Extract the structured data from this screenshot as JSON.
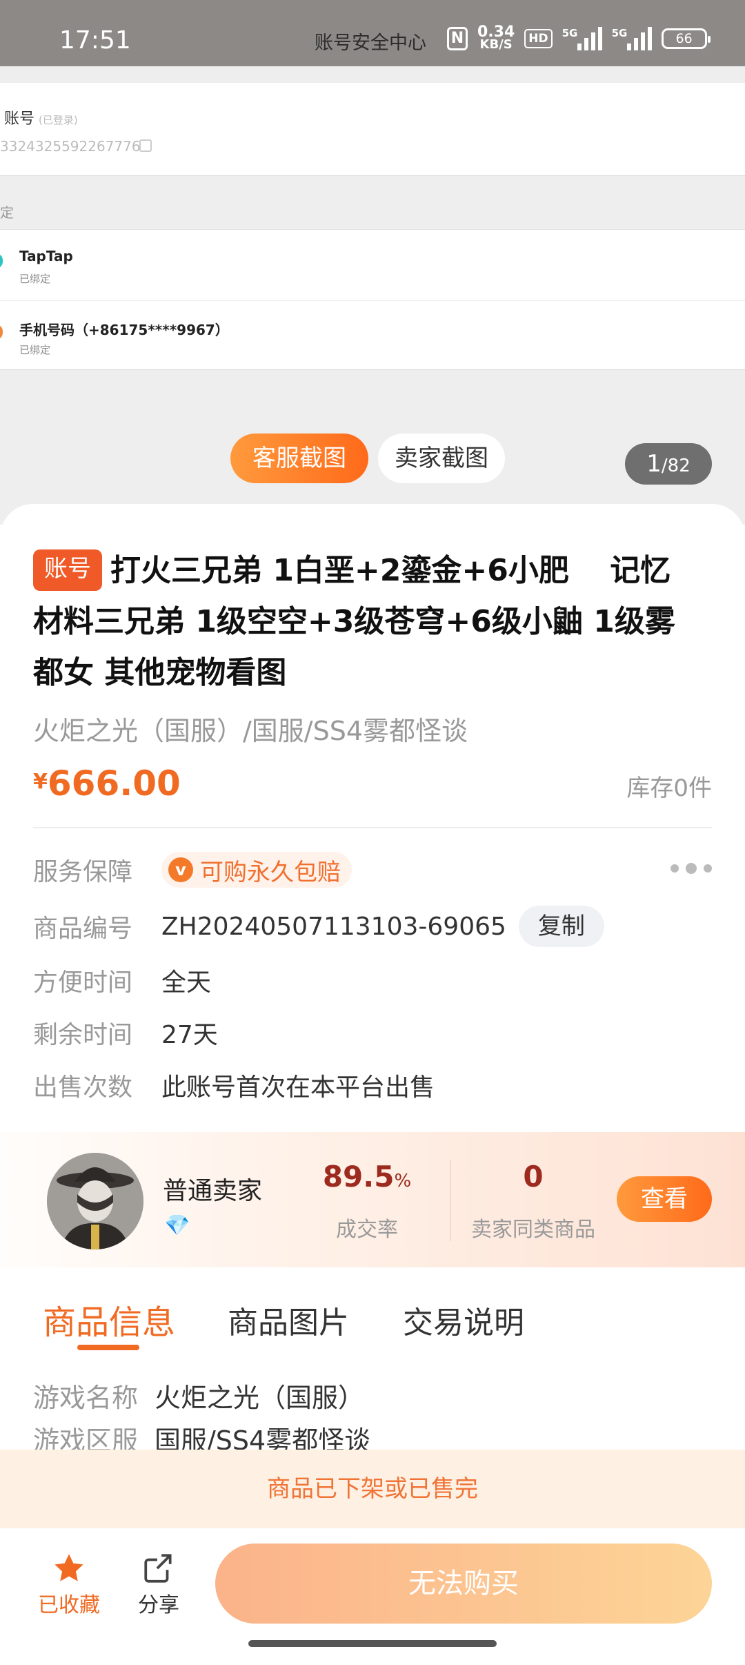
{
  "status_bar": {
    "time": "17:51",
    "title": "账号安全中心",
    "nfc": "N",
    "speed_value": "0.34",
    "speed_unit": "KB/S",
    "hd": "HD",
    "sim1": "5G",
    "sim2": "5G",
    "battery": "66"
  },
  "gallery": {
    "account_label": "账号",
    "account_sub": "(已登录)",
    "account_number": "3324325592267776",
    "bind_section_label": "定",
    "bindings": [
      {
        "name": "TapTap",
        "status": "已绑定",
        "color": "#2bc4c4"
      },
      {
        "name": "手机号码（+86175****9967）",
        "status": "已绑定",
        "color": "#f08a3a"
      }
    ],
    "tab_kefu": "客服截图",
    "tab_seller": "卖家截图",
    "counter_current": "1",
    "counter_total": "/82"
  },
  "product": {
    "tag": "账号",
    "title": "打火三兄弟 1白垩+2鎏金+6小肥　 记忆材料三兄弟  1级空空+3级苍穹+6级小鼬   1级雾都女 其他宠物看图",
    "subtitle": "火炬之光（国服）/国服/SS4雾都怪谈",
    "currency": "¥",
    "price": "666.00",
    "stock": "库存0件",
    "accent_color": "#f06a22"
  },
  "info": {
    "service_label": "服务保障",
    "service_value": "可购永久包赔",
    "service_icon": "v",
    "code_label": "商品编号",
    "code_value": "ZH20240507113103-69065",
    "copy_label": "复制",
    "time_label": "方便时间",
    "time_value": "全天",
    "remain_label": "剩余时间",
    "remain_value": "27天",
    "sales_label": "出售次数",
    "sales_value": "此账号首次在本平台出售"
  },
  "seller": {
    "name": "普通卖家",
    "rate_value": "89.5",
    "rate_unit": "%",
    "rate_label": "成交率",
    "same_count": "0",
    "same_label": "卖家同类商品",
    "view_label": "查看"
  },
  "tabs": {
    "items": [
      "商品信息",
      "商品图片",
      "交易说明"
    ],
    "active": 0
  },
  "details": [
    {
      "label": "游戏名称",
      "value": "火炬之光（国服）"
    },
    {
      "label": "游戏区服",
      "value": "国服/SS4雾都怪谈"
    }
  ],
  "notice": "商品已下架或已售完",
  "bottom": {
    "fav_label": "已收藏",
    "share_label": "分享",
    "buy_label": "无法购买"
  }
}
